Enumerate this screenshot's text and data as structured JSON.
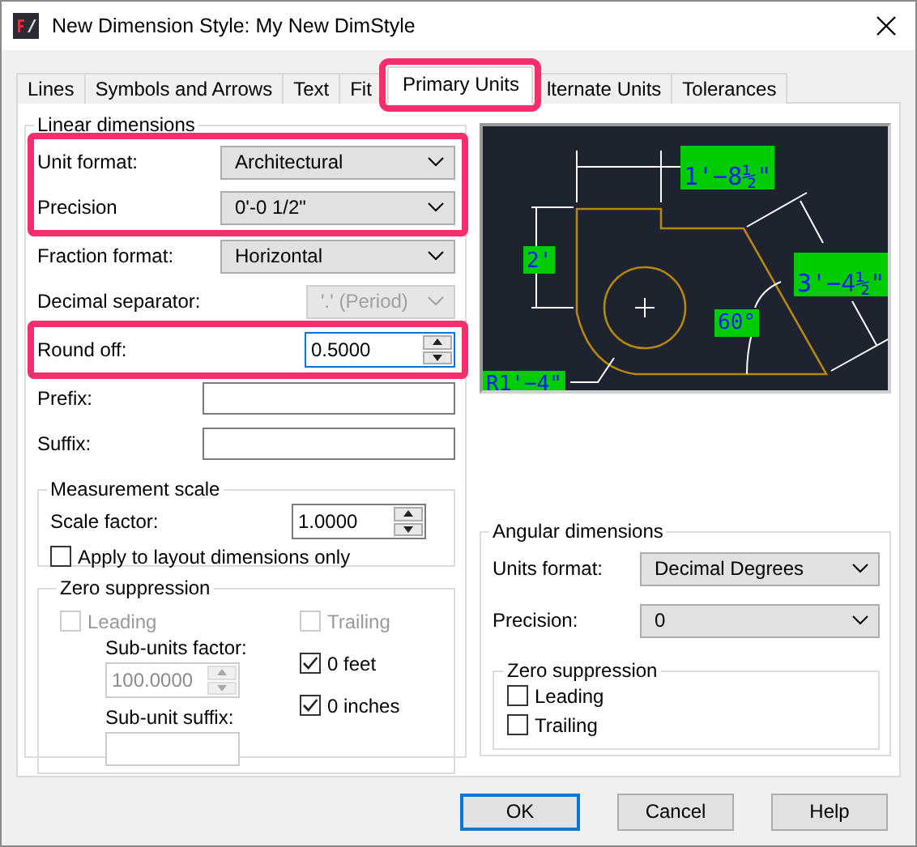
{
  "window": {
    "title": "New Dimension Style: My New DimStyle"
  },
  "tabs": [
    {
      "label": "Lines",
      "selected": false,
      "highlighted": false
    },
    {
      "label": "Symbols and Arrows",
      "selected": false,
      "highlighted": false
    },
    {
      "label": "Text",
      "selected": false,
      "highlighted": false
    },
    {
      "label": "Fit",
      "selected": false,
      "highlighted": false
    },
    {
      "label": "Primary Units",
      "selected": true,
      "highlighted": true
    },
    {
      "label": "lternate Units",
      "selected": false,
      "highlighted": false
    },
    {
      "label": "Tolerances",
      "selected": false,
      "highlighted": false
    }
  ],
  "linear_dimensions": {
    "title": "Linear dimensions",
    "fields": [
      {
        "kind": "select",
        "label": "Unit format:",
        "value": "Architectural",
        "disabled": false,
        "highlighted": true
      },
      {
        "kind": "select",
        "label": "Precision",
        "value": "0'-0 1/2\"",
        "disabled": false,
        "highlighted": true
      },
      {
        "kind": "select",
        "label": "Fraction format:",
        "value": "Horizontal",
        "disabled": false,
        "highlighted": false
      },
      {
        "kind": "select",
        "label": "Decimal separator:",
        "value": "'.' (Period)",
        "disabled": true,
        "highlighted": false
      },
      {
        "kind": "spinner",
        "label": "Round off:",
        "value": "0.5000",
        "disabled": false,
        "highlighted": true
      },
      {
        "kind": "text",
        "label": "Prefix:",
        "disabled": false,
        "highlighted": false
      },
      {
        "kind": "text",
        "label": "Suffix:",
        "disabled": false,
        "highlighted": false
      }
    ]
  },
  "measurement_scale": {
    "title": "Measurement scale",
    "scale_factor": {
      "label": "Scale factor:",
      "value": "1.0000"
    },
    "apply_to_layout": {
      "label": "Apply to layout dimensions only",
      "checked": false
    }
  },
  "zero_suppression": {
    "title": "Zero suppression",
    "leading": {
      "label": "Leading",
      "checked": false,
      "disabled": true
    },
    "sub_units_factor": {
      "label": "Sub-units factor:",
      "value": "100.0000",
      "disabled": true
    },
    "sub_unit_suffix": {
      "label": "Sub-unit suffix:"
    },
    "trailing": {
      "label": "Trailing",
      "checked": false,
      "disabled": true
    },
    "feet": {
      "label": "0 feet",
      "checked": true,
      "disabled": false
    },
    "inches": {
      "label": "0 inches",
      "checked": true,
      "disabled": false
    }
  },
  "preview": {
    "labels": [
      "1'−8½\"",
      "2'",
      "3'−4½\"",
      "60°",
      "R1'−4\""
    ]
  },
  "angular_dimensions": {
    "title": "Angular dimensions",
    "fields": [
      {
        "kind": "select",
        "label": "Units format:",
        "value": "Decimal Degrees"
      },
      {
        "kind": "select",
        "label": "Precision:",
        "value": "0"
      }
    ],
    "zero_suppression": {
      "title": "Zero suppression",
      "options": [
        {
          "label": "Leading",
          "checked": false
        },
        {
          "label": "Trailing",
          "checked": false
        }
      ]
    }
  },
  "buttons": [
    {
      "label": "OK",
      "default": true
    },
    {
      "label": "Cancel",
      "default": false
    },
    {
      "label": "Help",
      "default": false
    }
  ]
}
